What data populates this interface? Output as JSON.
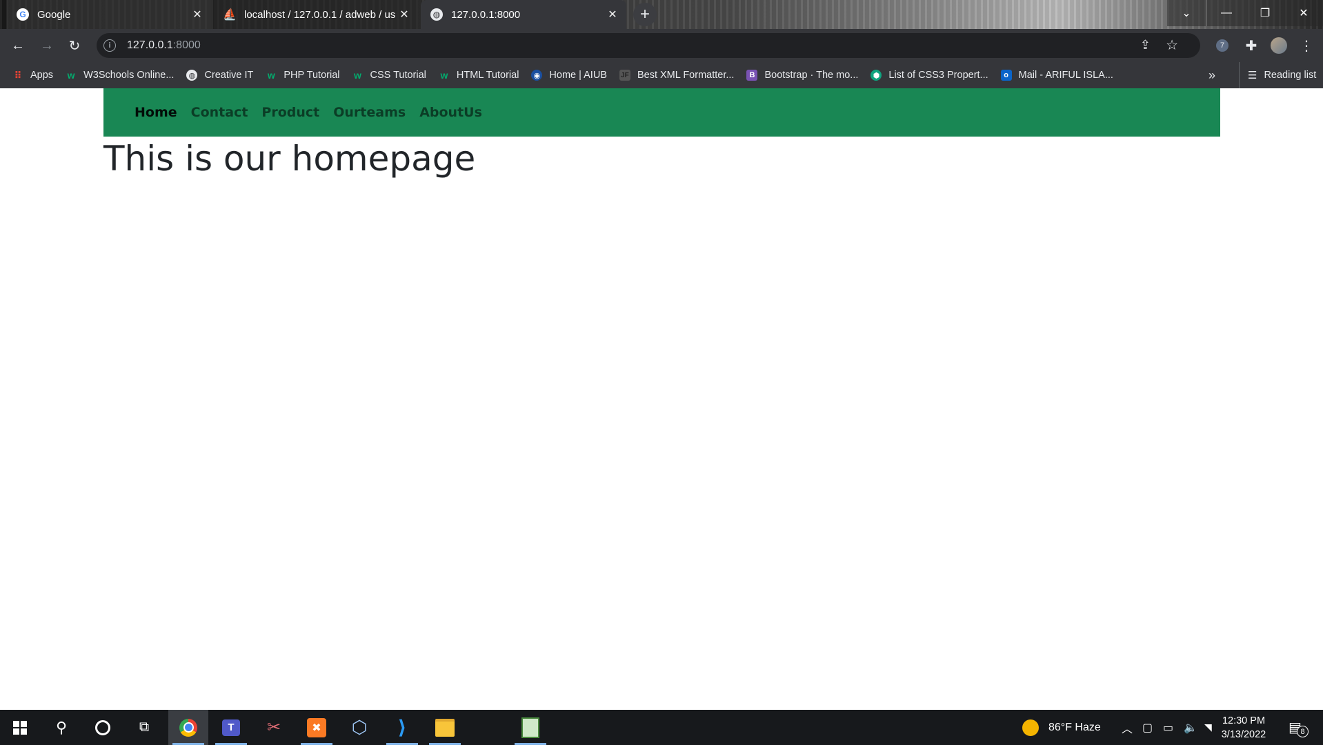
{
  "browser": {
    "tabs": [
      {
        "title": "Google"
      },
      {
        "title": "localhost / 127.0.0.1 / adweb / us"
      },
      {
        "title": "127.0.0.1:8000"
      }
    ],
    "address": {
      "host": "127.0.0.1",
      "port": ":8000"
    },
    "bookmarks": [
      {
        "label": "Apps",
        "icon": "apps-grid-icon"
      },
      {
        "label": "W3Schools Online...",
        "icon": "w3schools-icon"
      },
      {
        "label": "Creative IT",
        "icon": "globe-icon"
      },
      {
        "label": "PHP Tutorial",
        "icon": "w3schools-icon"
      },
      {
        "label": "CSS Tutorial",
        "icon": "w3schools-icon"
      },
      {
        "label": "HTML Tutorial",
        "icon": "w3schools-icon"
      },
      {
        "label": "Home | AIUB",
        "icon": "aiub-icon"
      },
      {
        "label": "Best XML Formatter...",
        "icon": "jsonformatter-icon"
      },
      {
        "label": "Bootstrap · The mo...",
        "icon": "bootstrap-icon"
      },
      {
        "label": "List of CSS3 Propert...",
        "icon": "shield-icon"
      },
      {
        "label": "Mail - ARIFUL ISLA...",
        "icon": "outlook-icon"
      }
    ],
    "more_label": "»",
    "reading_list": "Reading list"
  },
  "page": {
    "nav": [
      {
        "label": "Home",
        "active": true
      },
      {
        "label": "Contact"
      },
      {
        "label": "Product"
      },
      {
        "label": "Ourteams"
      },
      {
        "label": "AboutUs"
      }
    ],
    "heading": "This is our homepage",
    "nav_color": "#198754"
  },
  "taskbar": {
    "weather": "86°F Haze",
    "time": "12:30 PM",
    "date": "3/13/2022",
    "notification_count": "8"
  }
}
